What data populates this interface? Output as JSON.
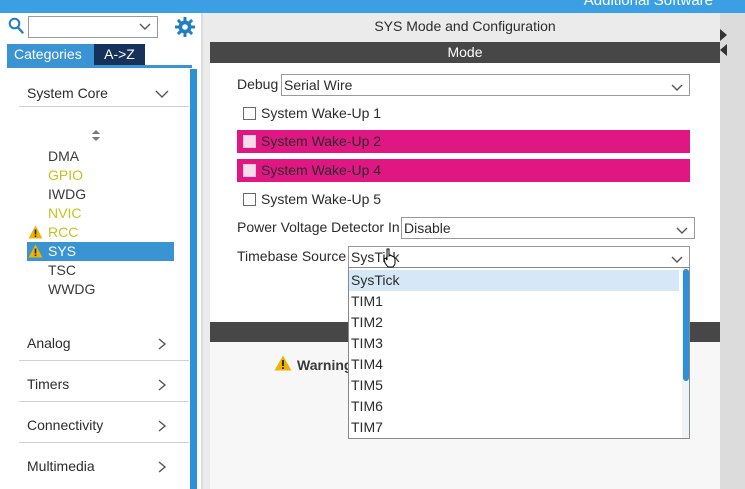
{
  "top_bar": {
    "right_text": "Additional Software"
  },
  "left_panel": {
    "tabs": {
      "categories": "Categories",
      "az": "A->Z"
    },
    "sections": [
      {
        "label": "System Core",
        "expanded": true
      },
      {
        "label": "Analog",
        "expanded": false
      },
      {
        "label": "Timers",
        "expanded": false
      },
      {
        "label": "Connectivity",
        "expanded": false
      },
      {
        "label": "Multimedia",
        "expanded": false
      }
    ],
    "items": [
      {
        "label": "DMA",
        "style": "normal",
        "warning": false
      },
      {
        "label": "GPIO",
        "style": "yellow",
        "warning": false
      },
      {
        "label": "IWDG",
        "style": "normal",
        "warning": false
      },
      {
        "label": "NVIC",
        "style": "yellow",
        "warning": false
      },
      {
        "label": "RCC",
        "style": "yellow",
        "warning": true
      },
      {
        "label": "SYS",
        "style": "selected",
        "warning": true
      },
      {
        "label": "TSC",
        "style": "normal",
        "warning": false
      },
      {
        "label": "WWDG",
        "style": "normal",
        "warning": false
      }
    ]
  },
  "config": {
    "title": "SYS Mode and Configuration",
    "mode_header": "Mode",
    "debug": {
      "label": "Debug",
      "value": "Serial Wire"
    },
    "wakeups": [
      {
        "label": "System Wake-Up 1",
        "highlighted": false
      },
      {
        "label": "System Wake-Up 2",
        "highlighted": true
      },
      {
        "label": "System Wake-Up 4",
        "highlighted": true
      },
      {
        "label": "System Wake-Up 5",
        "highlighted": false
      }
    ],
    "pvd": {
      "label": "Power Voltage Detector In",
      "value": "Disable"
    },
    "timebase": {
      "label": "Timebase Source",
      "value": "SysTick",
      "options": [
        "SysTick",
        "TIM1",
        "TIM2",
        "TIM3",
        "TIM4",
        "TIM5",
        "TIM6",
        "TIM7"
      ],
      "active_index": 0
    },
    "warning_text": "Warning"
  },
  "colors": {
    "accent_blue": "#3a94d4",
    "highlight_pink": "#e01783",
    "dark_bar": "#474747",
    "yellow_item": "#c9c21a"
  }
}
